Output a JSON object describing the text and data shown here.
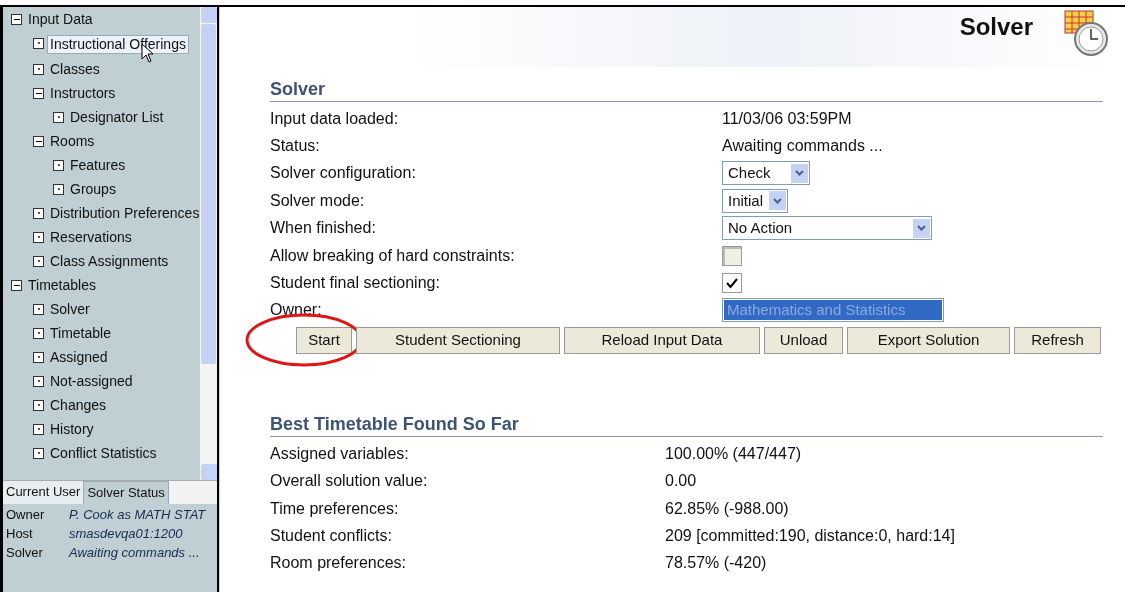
{
  "sidebar": {
    "tree": [
      {
        "label": "Input Data",
        "expanded": true,
        "selected": false,
        "children": [
          {
            "label": "Instructional Offerings",
            "selected": true
          },
          {
            "label": "Classes",
            "selected": false
          },
          {
            "label": "Instructors",
            "expanded": true,
            "selected": false,
            "children": [
              {
                "label": "Designator List",
                "selected": false
              }
            ]
          },
          {
            "label": "Rooms",
            "expanded": true,
            "selected": false,
            "children": [
              {
                "label": "Features",
                "selected": false
              },
              {
                "label": "Groups",
                "selected": false
              }
            ]
          },
          {
            "label": "Distribution Preferences",
            "selected": false
          },
          {
            "label": "Reservations",
            "selected": false
          },
          {
            "label": "Class Assignments",
            "selected": false
          }
        ]
      },
      {
        "label": "Timetables",
        "expanded": true,
        "selected": false,
        "children": [
          {
            "label": "Solver",
            "selected": false
          },
          {
            "label": "Timetable",
            "selected": false
          },
          {
            "label": "Assigned",
            "selected": false
          },
          {
            "label": "Not-assigned",
            "selected": false
          },
          {
            "label": "Changes",
            "selected": false
          },
          {
            "label": "History",
            "selected": false
          },
          {
            "label": "Conflict Statistics",
            "selected": false
          }
        ]
      }
    ],
    "tabs": [
      {
        "label": "Current User",
        "selected": false
      },
      {
        "label": "Solver Status",
        "selected": true
      }
    ],
    "status": [
      {
        "label": "Owner",
        "value": "P. Cook as MATH STAT"
      },
      {
        "label": "Host",
        "value": "smasdevqa01:1200"
      },
      {
        "label": "Solver",
        "value": "Awaiting commands ..."
      }
    ]
  },
  "page_title": "Solver",
  "solver": {
    "title": "Solver",
    "rows": [
      {
        "kind": "text",
        "label": "Input data loaded:",
        "value": "11/03/06 03:59PM"
      },
      {
        "kind": "text",
        "label": "Status:",
        "value": "Awaiting commands ..."
      },
      {
        "kind": "select",
        "label": "Solver configuration:",
        "value": "Check"
      },
      {
        "kind": "select",
        "label": "Solver mode:",
        "value": "Initial"
      },
      {
        "kind": "select",
        "label": "When finished:",
        "value": "No Action"
      },
      {
        "kind": "checkbox",
        "label": "Allow breaking of hard constraints:",
        "checked": false,
        "disabled": true
      },
      {
        "kind": "checkbox",
        "label": "Student final sectioning:",
        "checked": true,
        "disabled": false
      },
      {
        "kind": "list",
        "label": "Owner:",
        "value": "Mathematics and Statistics",
        "selected": true
      }
    ],
    "buttons": [
      {
        "label": "Start",
        "highlighted": true
      },
      {
        "label": "Student Sectioning",
        "highlighted": false
      },
      {
        "label": "Reload Input Data",
        "highlighted": false
      },
      {
        "label": "Unload",
        "highlighted": false
      },
      {
        "label": "Export Solution",
        "highlighted": false
      },
      {
        "label": "Refresh",
        "highlighted": false
      }
    ]
  },
  "best": {
    "title": "Best Timetable Found So Far",
    "rows": [
      {
        "label": "Assigned variables:",
        "value": "100.00% (447/447)"
      },
      {
        "label": "Overall solution value:",
        "value": "0.00"
      },
      {
        "label": "Time preferences:",
        "value": "62.85% (-988.00)"
      },
      {
        "label": "Student conflicts:",
        "value": "209 [committed:190, distance:0, hard:14]"
      },
      {
        "label": "Room preferences:",
        "value": "78.57% (-420)"
      }
    ]
  }
}
